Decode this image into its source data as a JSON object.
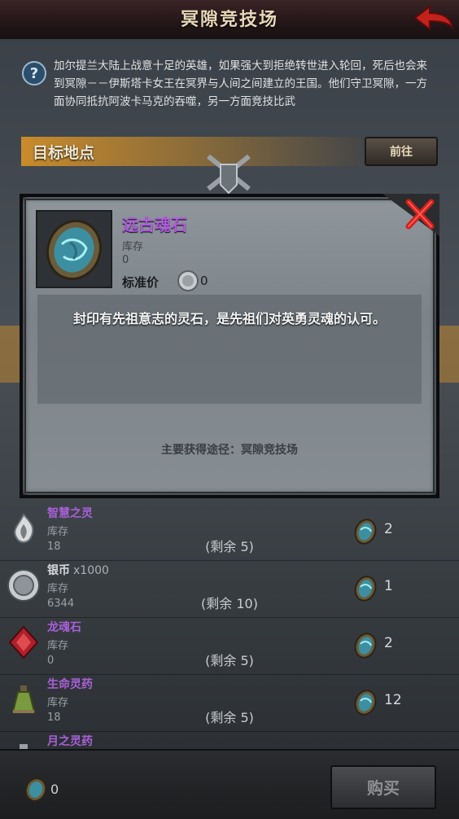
{
  "header": {
    "title": "冥隙竞技场"
  },
  "intro": {
    "text": "加尔提兰大陆上战意十足的英雄，如果强大到拒绝转世进入轮回，死后也会来到冥隙－－伊斯塔卡女王在冥界与人间之间建立的王国。他们守卫冥隙，一方面协同抵抗阿波卡马克的吞噬，另一方面竞技比武"
  },
  "target": {
    "label": "目标地点",
    "goto_label": "前往"
  },
  "modal": {
    "item_name": "远古魂石",
    "stock_label": "库存",
    "stock_value": "0",
    "price_label": "标准价",
    "price_value": "0",
    "description": "封印有先祖意志的灵石，是先祖们对英勇灵魂的认可。",
    "source": "主要获得途径：冥隙竞技场"
  },
  "list": [
    {
      "name": "智慧之灵",
      "name_color": "#a860d8",
      "stock_label": "库存",
      "stock": "18",
      "remain": "(剩余 5)",
      "cost": "2"
    },
    {
      "name": "银币",
      "qty": "x1000",
      "name_color": "#d8dadc",
      "stock_label": "库存",
      "stock": "6344",
      "remain": "(剩余 10)",
      "cost": "1"
    },
    {
      "name": "龙魂石",
      "name_color": "#a860d8",
      "stock_label": "库存",
      "stock": "0",
      "remain": "(剩余 5)",
      "cost": "2"
    },
    {
      "name": "生命灵药",
      "name_color": "#a860d8",
      "stock_label": "库存",
      "stock": "18",
      "remain": "(剩余 5)",
      "cost": "12"
    },
    {
      "name": "月之灵药",
      "name_color": "#a860d8"
    }
  ],
  "bottom": {
    "balance": "0",
    "buy_label": "购买"
  },
  "colors": {
    "accent_purple": "#a860d8",
    "target_orange": "#c98b2b",
    "close_red": "#d0201c"
  },
  "icons": {
    "help": "question-icon",
    "back": "back-arrow-icon",
    "close": "close-x-icon",
    "soulstone": "soulstone-icon",
    "silver": "silver-coin-icon"
  }
}
